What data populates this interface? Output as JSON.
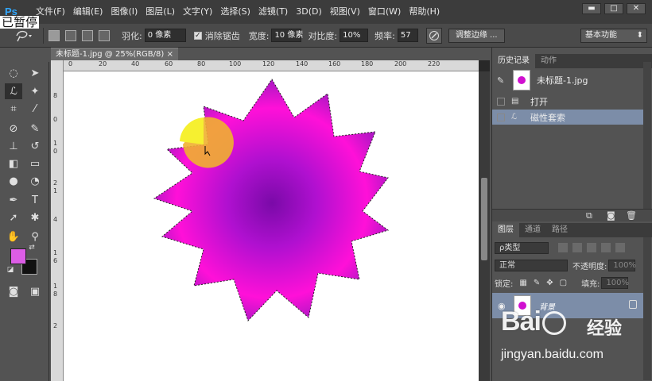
{
  "app": {
    "logo": "Ps",
    "pause_text": "已暂停"
  },
  "menu": [
    "文件(F)",
    "编辑(E)",
    "图像(I)",
    "图层(L)",
    "文字(Y)",
    "选择(S)",
    "滤镜(T)",
    "3D(D)",
    "视图(V)",
    "窗口(W)",
    "帮助(H)"
  ],
  "window_controls": {
    "minimize": "▬",
    "maximize": "□",
    "close": "✕"
  },
  "options": {
    "feather_label": "羽化:",
    "feather_value": "0 像素",
    "antialias_label": "消除锯齿",
    "antialias_checked": true,
    "width_label": "宽度:",
    "width_value": "10 像素",
    "contrast_label": "对比度:",
    "contrast_value": "10%",
    "frequency_label": "频率:",
    "frequency_value": "57",
    "refine_button": "调整边缘 ...",
    "workspace": "基本功能"
  },
  "document": {
    "tab_title": "未标题-1.jpg @ 25%(RGB/8)",
    "close_glyph": "×",
    "ruler_h": [
      "0",
      "20",
      "40",
      "60",
      "80",
      "100",
      "120",
      "140",
      "160",
      "180",
      "200",
      "220"
    ],
    "ruler_v": [
      "8",
      "0",
      "1",
      "0",
      "2",
      "1",
      "4",
      "1",
      "6",
      "1",
      "8",
      "2"
    ]
  },
  "tools": {
    "colors": {
      "foreground": "#dc5de6",
      "background": "#111111"
    }
  },
  "history_panel": {
    "tabs": [
      "历史记录",
      "动作"
    ],
    "snapshot": "未标题-1.jpg",
    "rows": [
      {
        "label": "打开",
        "icon": "document-icon",
        "selected": false
      },
      {
        "label": "磁性套索",
        "icon": "magnetic-lasso-icon",
        "selected": true
      }
    ]
  },
  "layers_panel": {
    "tabs": [
      "图层",
      "通道",
      "路径"
    ],
    "filter_label": "ρ类型",
    "blend_mode": "正常",
    "opacity_label": "不透明度:",
    "opacity_value": "100%",
    "lock_label": "锁定:",
    "fill_label": "填充:",
    "fill_value": "100%",
    "layer_name": "背景"
  },
  "watermark": {
    "logo": "Bai 经验",
    "logo_cn": "经验",
    "url": "jingyan.baidu.com"
  },
  "colors": {
    "accent_selection": "#7c8da8",
    "flower_center": "#8a0fb0",
    "flower_edge": "#ff1ee0",
    "lasso_fill": "#f0b030"
  }
}
